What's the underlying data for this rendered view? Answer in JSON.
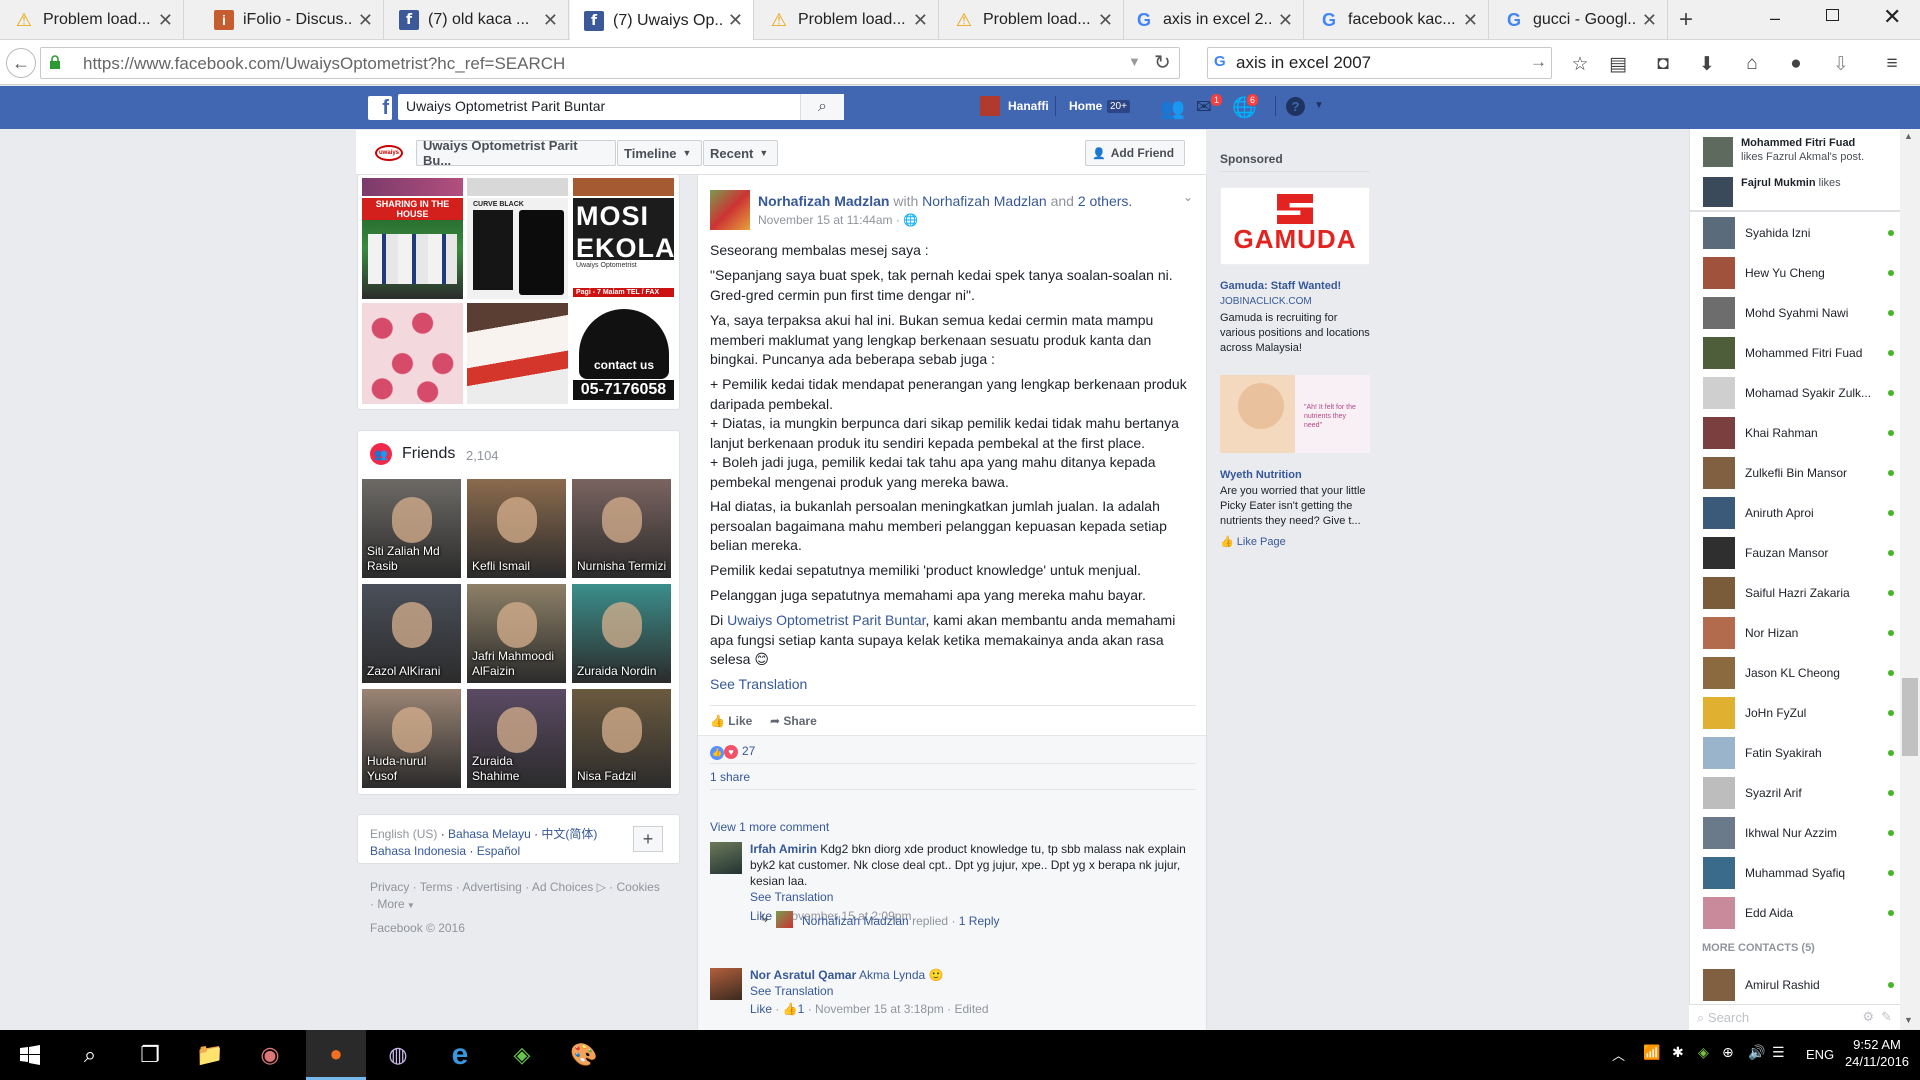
{
  "browser": {
    "tabs": [
      {
        "icon": "warning-icon",
        "title": "Problem load..."
      },
      {
        "icon": "ifolio-icon",
        "title": "iFolio - Discus..."
      },
      {
        "icon": "facebook-icon",
        "title": "(7) old kaca ..."
      },
      {
        "icon": "facebook-icon",
        "title": "(7) Uwaiys Op...",
        "active": true
      },
      {
        "icon": "warning-icon",
        "title": "Problem load..."
      },
      {
        "icon": "warning-icon",
        "title": "Problem load..."
      },
      {
        "icon": "google-icon",
        "title": "axis in excel 2..."
      },
      {
        "icon": "google-icon",
        "title": "facebook kac..."
      },
      {
        "icon": "google-icon",
        "title": "gucci - Googl..."
      }
    ],
    "url": "https://www.facebook.com/UwaiysOptometrist?hc_ref=SEARCH",
    "url_domain": "www.facebook.com",
    "search_text": "axis in excel 2007"
  },
  "fb": {
    "search_value": "Uwaiys Optometrist Parit Buntar",
    "user_name": "Hanaffi",
    "home_label": "Home",
    "home_badge": "20+",
    "msg_badge": "1",
    "notif_badge": "6"
  },
  "page_header": {
    "page_name": "Uwaiys Optometrist Parit Bu...",
    "timeline_label": "Timeline",
    "recent_label": "Recent",
    "add_friend_label": "Add Friend"
  },
  "photos_text": {
    "p1": "SHARING IN THE HOUSE",
    "p2": "CURVE BLACK",
    "p3": "MOSI EKOLAH",
    "p3_sub": "Uwaiys Optometrist",
    "p3_hours": "Pagi - 7 Malam TEL / FAX",
    "p4": "contact us",
    "p4_num": "05-7176058"
  },
  "friends": {
    "title": "Friends",
    "count": "2,104",
    "list": [
      {
        "name": "Siti Zaliah Md Rasib",
        "color": "#6d6a66"
      },
      {
        "name": "Kefli Ismail",
        "color": "#8b6b4d"
      },
      {
        "name": "Nurnisha Termizi",
        "color": "#7a6460"
      },
      {
        "name": "Zazol AlKirani",
        "color": "#4a4f5a"
      },
      {
        "name": "Jafri Mahmoodi AlFaizin",
        "color": "#8e8067"
      },
      {
        "name": "Zuraida Nordin",
        "color": "#3b8f8c"
      },
      {
        "name": "Huda-nurul Yusof",
        "color": "#9b8575"
      },
      {
        "name": "Zuraida Shahime",
        "color": "#5b4a64"
      },
      {
        "name": "Nisa Fadzil",
        "color": "#6b5a3f"
      }
    ]
  },
  "languages": {
    "current": "English (US)",
    "l1": "Bahasa Melayu",
    "l2": "中文(简体)",
    "l3": "Bahasa Indonesia",
    "l4": "Español"
  },
  "footer": {
    "privacy": "Privacy",
    "terms": "Terms",
    "advertising": "Advertising",
    "adchoices": "Ad Choices",
    "cookies": "Cookies",
    "more": "More",
    "copyright": "Facebook © 2016"
  },
  "post": {
    "author": "Norhafizah Madzlan",
    "with": "with",
    "tagged": "Norhafizah Madzlan",
    "and": "and",
    "others": "2 others.",
    "time": "November 15 at 11:44am",
    "p1": "Seseorang membalas mesej saya :",
    "p2": "\"Sepanjang saya buat spek, tak pernah kedai spek tanya soalan-soalan ni. Gred-gred cermin pun first time dengar ni\".",
    "p3": "Ya, saya terpaksa akui hal ini. Bukan semua kedai cermin mata mampu memberi maklumat yang lengkap berkenaan sesuatu produk kanta dan bingkai. Puncanya ada beberapa sebab juga :",
    "p4": "+ Pemilik kedai tidak mendapat penerangan yang lengkap berkenaan produk daripada pembekal.",
    "p5": "+ Diatas, ia mungkin berpunca dari sikap pemilik kedai tidak mahu bertanya lanjut berkenaan produk itu sendiri kepada pembekal at the first place.",
    "p6": "+ Boleh jadi juga, pemilik kedai tak tahu apa yang mahu ditanya kepada pembekal mengenai produk yang mereka bawa.",
    "p7": "Hal diatas, ia bukanlah persoalan meningkatkan jumlah jualan. Ia adalah persoalan bagaimana mahu memberi pelanggan kepuasan kepada setiap belian mereka.",
    "p8": "Pemilik kedai sepatutnya memiliki 'product knowledge' untuk menjual.",
    "p9": "Pelanggan juga sepatutnya memahami apa yang mereka mahu bayar.",
    "p10_pre": "Di",
    "p10_link": "Uwaiys Optometrist Parit Buntar",
    "p10_post": ", kami akan membantu anda memahami apa fungsi setiap kanta supaya kelak ketika memakainya anda akan rasa selesa",
    "see_translation": "See Translation",
    "like": "Like",
    "share": "Share",
    "reactions": "27",
    "shares": "1 share",
    "view_more": "View 1 more comment"
  },
  "comments": [
    {
      "author": "Irfah Amirin",
      "text": "Kdg2 bkn diorg xde product knowledge tu, tp sbb malass nak explain byk2 kat customer. Nk close deal cpt.. Dpt yg jujur, xpe.. Dpt yg x berapa nk jujur, kesian laa.",
      "see_translation": "See Translation",
      "like": "Like",
      "time": "November 15 at 2:09pm",
      "reply_author": "Norhafizah Madzlan",
      "reply_verb": "replied",
      "reply_count": "1 Reply"
    },
    {
      "author": "Nor Asratul Qamar",
      "tag": "Akma Lynda",
      "see_translation": "See Translation",
      "like": "Like",
      "likes": "1",
      "time": "November 15 at 3:18pm",
      "edited": "Edited"
    }
  ],
  "sponsored": {
    "title": "Sponsored",
    "ad1": {
      "brand": "GAMUDA",
      "headline": "Gamuda: Staff Wanted!",
      "domain": "JOBINACLICK.COM",
      "text": "Gamuda is recruiting for various positions and locations across Malaysia!"
    },
    "ad2": {
      "headline": "Wyeth Nutrition",
      "text": "Are you worried that your little Picky Eater isn't getting the nutrients they need? Give t...",
      "like_page": "Like Page",
      "img_text": "\"Ah! It felt for the nutrients they need\""
    }
  },
  "chat": {
    "ticker": [
      {
        "name": "Mohammed Fitri Fuad",
        "action": "likes Fazrul Akmal's post."
      },
      {
        "name": "Fajrul Mukmin",
        "action": "likes"
      }
    ],
    "contacts": [
      "Syahida Izni",
      "Hew Yu Cheng",
      "Mohd Syahmi Nawi",
      "Mohammed Fitri Fuad",
      "Mohamad Syakir Zulk...",
      "Khai Rahman",
      "Zulkefli Bin Mansor",
      "Aniruth Aproi",
      "Fauzan Mansor",
      "Saiful Hazri Zakaria",
      "Nor Hizan",
      "Jason KL Cheong",
      "JoHn FyZul",
      "Fatin Syakirah",
      "Syazril Arif",
      "Ikhwal Nur Azzim",
      "Muhammad Syafiq",
      "Edd Aida"
    ],
    "more_contacts": "MORE CONTACTS (5)",
    "more_list": [
      "Amirul Rashid"
    ],
    "search_placeholder": "Search"
  },
  "taskbar": {
    "time": "9:52 AM",
    "date": "24/11/2016",
    "lang": "ENG"
  }
}
